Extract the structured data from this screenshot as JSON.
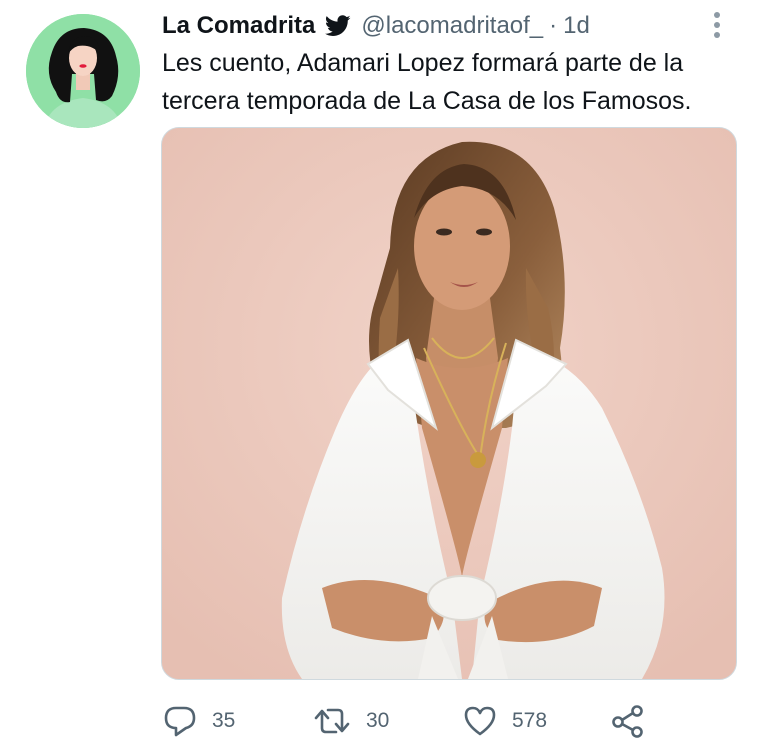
{
  "tweet": {
    "display_name": "La Comadrita",
    "handle": "@lacomadritaof_",
    "separator": "·",
    "time": "1d",
    "text": "Les cuento, Adamari Lopez formará parte de la tercera temporada de La Casa de los Famosos.",
    "avatar_bg": "#8fe0a6",
    "media_bg": "#ecc7bb"
  },
  "actions": {
    "reply_count": "35",
    "retweet_count": "30",
    "like_count": "578"
  },
  "icons": {
    "brand": "bird-icon",
    "more": "vertical-dots-icon",
    "reply": "speech-bubble-icon",
    "retweet": "retweet-arrows-icon",
    "like": "heart-icon",
    "share": "share-nodes-icon"
  },
  "colors": {
    "text": "#0f1419",
    "muted": "#536471",
    "border": "#cfd9de"
  }
}
